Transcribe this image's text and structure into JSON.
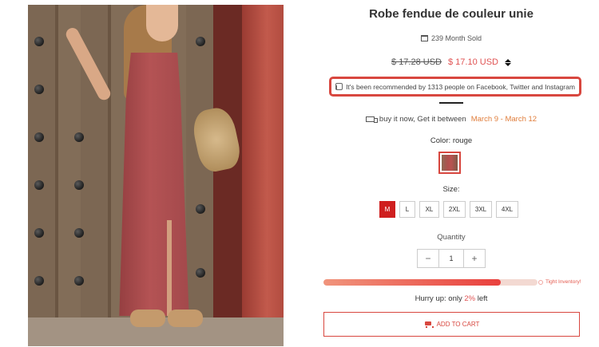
{
  "product": {
    "title": "Robe fendue de couleur unie",
    "sold_text": "239 Month Sold",
    "old_price": "$ 17.28 USD",
    "new_price": "$ 17.10 USD",
    "recommendation": "It's been recommended by 1313 people on Facebook, Twitter and Instagram",
    "delivery_prefix": "buy it now, Get it between",
    "delivery_dates": "March 9 - March 12",
    "color_label": "Color: rouge",
    "size_label": "Size:",
    "sizes": [
      "M",
      "L",
      "XL",
      "2XL",
      "3XL",
      "4XL"
    ],
    "selected_size": "M",
    "quantity_label": "Quantity",
    "quantity_value": "1",
    "stock_level": 0.83,
    "stock_note": "Tight Inventory!",
    "hurry_prefix": "Hurry up: only",
    "hurry_count": "2%",
    "hurry_suffix": "left",
    "add_to_cart": "ADD TO CART"
  },
  "colors": {
    "accent": "#d8473f",
    "price_red": "#e05252",
    "date_orange": "#e07d3b",
    "selected_size_bg": "#cf1f1f"
  },
  "icons": {
    "sold": "calendar-icon",
    "price_toggle": "sort-icon",
    "recommend": "thumbs-up-icon",
    "delivery": "truck-icon",
    "cart": "cart-icon"
  }
}
